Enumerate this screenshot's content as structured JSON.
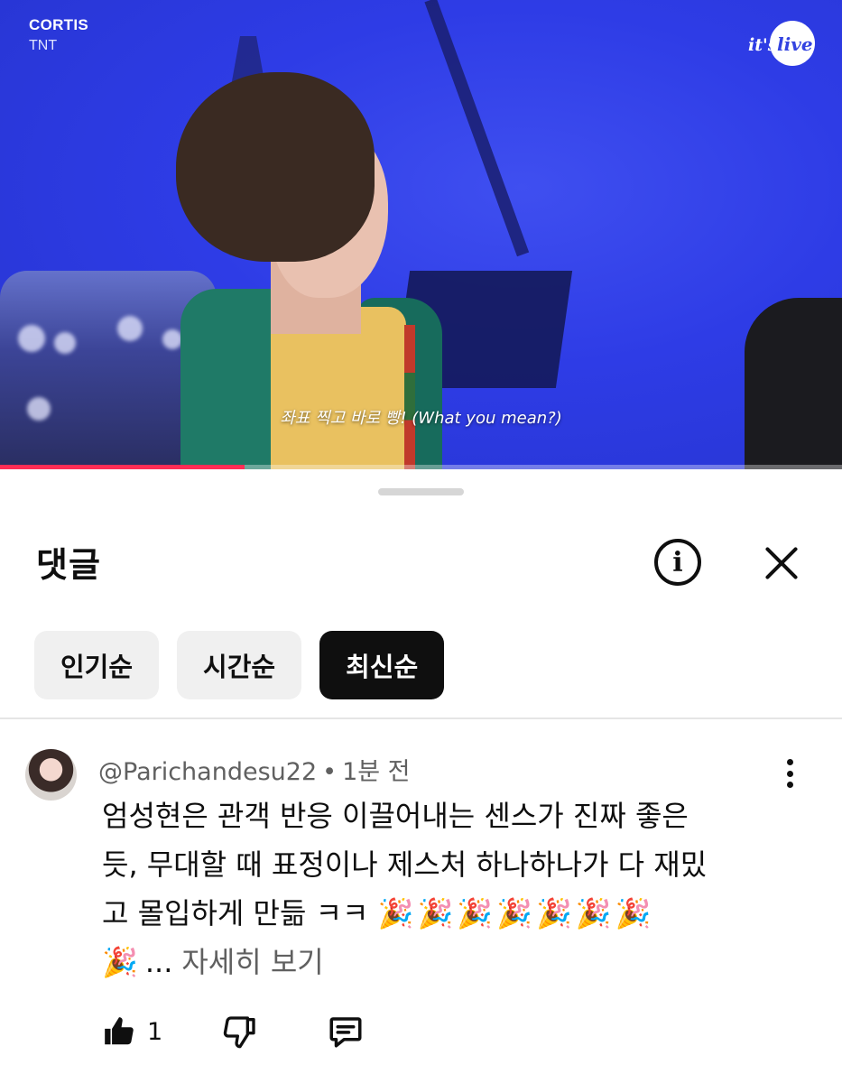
{
  "video": {
    "artist": "CORTIS",
    "track": "TNT",
    "logo_lead": "it's",
    "logo_tail": "live",
    "subtitle": "좌표 찍고 바로 빵! (What you mean?)",
    "progress": 0.29,
    "accent_color": "#ff2d55"
  },
  "comments_panel": {
    "title": "댓글",
    "info_icon": "info-icon",
    "close_icon": "close-icon",
    "sort_tabs": [
      {
        "label": "인기순",
        "active": false
      },
      {
        "label": "시간순",
        "active": false
      },
      {
        "label": "최신순",
        "active": true
      }
    ]
  },
  "comment": {
    "author": "@Parichandesu22",
    "separator": "•",
    "time": "1분 전",
    "lines": [
      "엄성현은 관객 반응 이끌어내는 센스가 진짜 좋은",
      "듯, 무대할 때 표정이나 제스처 하나하나가 다 재밌",
      "고 몰입하게 만듦 ㅋㅋ"
    ],
    "emoji": "🎉",
    "ellipsis": "...",
    "see_more": "자세히 보기",
    "like_count": "1"
  }
}
